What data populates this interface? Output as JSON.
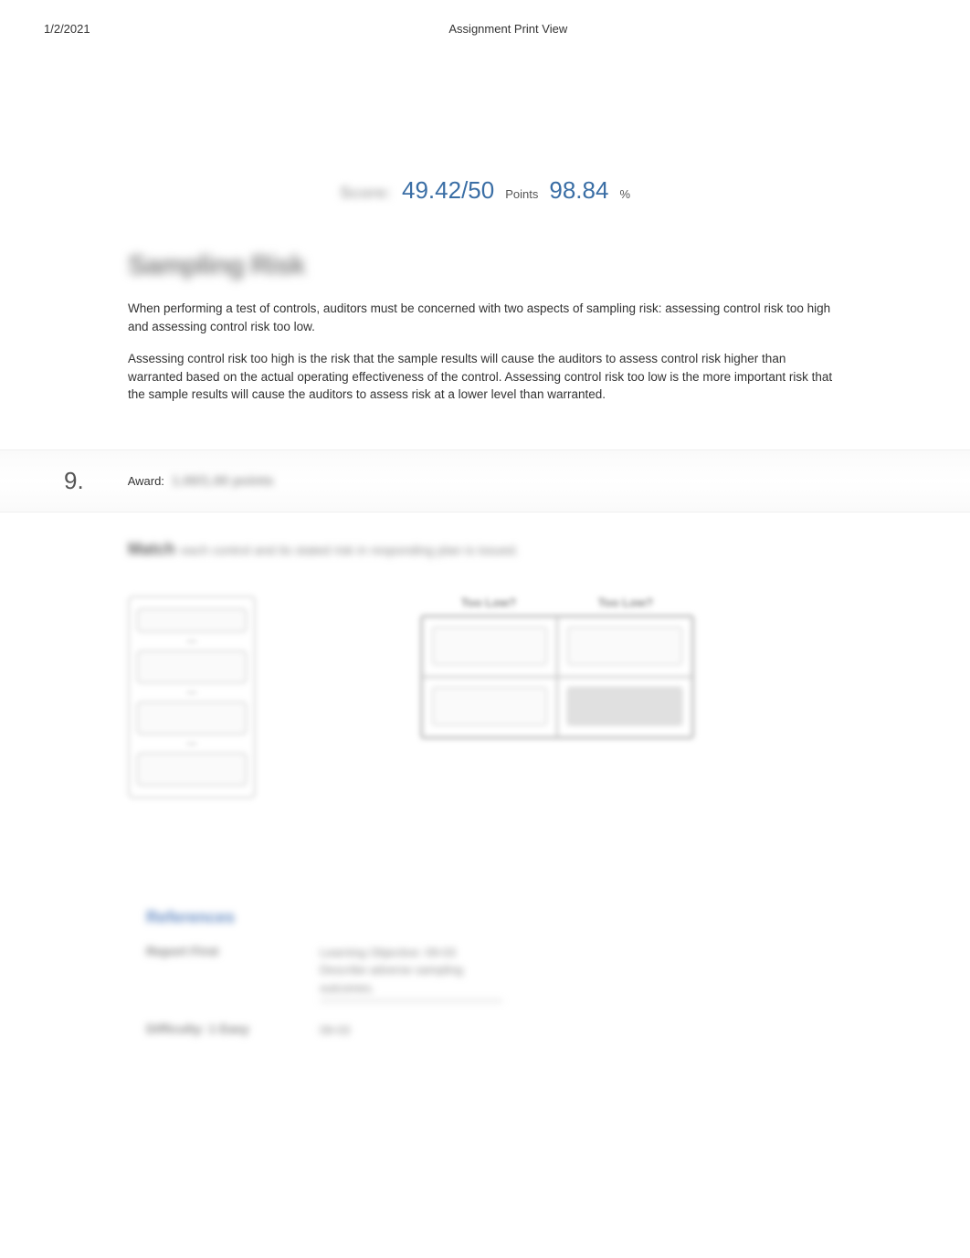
{
  "header": {
    "date": "1/2/2021",
    "title": "Assignment Print View"
  },
  "score": {
    "label_blur": "Score:",
    "points_value": "49.42/50",
    "points_unit": "Points",
    "percent_value": "98.84",
    "percent_unit": "%"
  },
  "section": {
    "heading_blur": "Sampling Risk",
    "para1": "When performing a test of controls, auditors must be concerned with two aspects of sampling risk: assessing control risk too high and assessing control risk too low.",
    "para2": "Assessing control risk too high is the risk that the sample results will cause the auditors to assess control risk higher than warranted based on the actual operating effectiveness of the control. Assessing control risk too low is the more important risk that the sample results will cause the auditors to assess risk at a lower level than warranted."
  },
  "question": {
    "number": "9.",
    "award_label": "Award:",
    "award_value_blur": "1.00/1.00 points"
  },
  "prompt": {
    "bold_blur": "Match",
    "text_blur": "each control and its stated risk in responding plan is issued."
  },
  "grid": {
    "header1": "Too Low?",
    "header2": "Too Low?"
  },
  "references": {
    "heading": "References",
    "row1_label": "Report First",
    "row1_value": "Learning Objective: 09-03 Describe adverse sampling outcomes.",
    "row2_label": "Difficulty: 1 Easy",
    "row2_value": "09-03"
  }
}
